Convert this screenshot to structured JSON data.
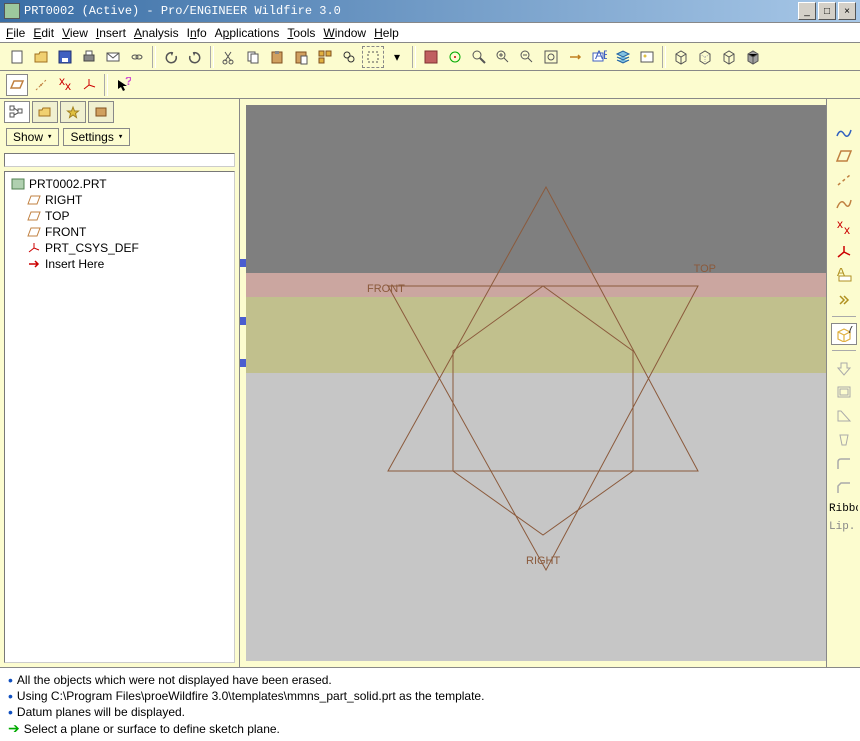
{
  "window": {
    "title": "PRT0002 (Active) - Pro/ENGINEER Wildfire 3.0"
  },
  "menu": {
    "file": "File",
    "edit": "Edit",
    "view": "View",
    "insert": "Insert",
    "analysis": "Analysis",
    "info": "Info",
    "applications": "Applications",
    "tools": "Tools",
    "window": "Window",
    "help": "Help"
  },
  "sidebar": {
    "show": "Show",
    "settings": "Settings",
    "root": "PRT0002.PRT",
    "items": [
      {
        "label": "RIGHT"
      },
      {
        "label": "TOP"
      },
      {
        "label": "FRONT"
      },
      {
        "label": "PRT_CSYS_DEF"
      },
      {
        "label": "Insert Here"
      }
    ]
  },
  "canvas": {
    "labels": {
      "top": "TOP",
      "front": "FRONT",
      "right": "RIGHT"
    }
  },
  "right_panel": {
    "ribbon": "Ribbon...",
    "lip": "Lip..."
  },
  "status": {
    "line1": "All the objects which were not displayed have been erased.",
    "line2": "Using C:\\Program Files\\proeWildfire 3.0\\templates\\mmns_part_solid.prt as the template.",
    "line3": "Datum planes will be displayed.",
    "line4": "Select a plane or surface to define sketch plane."
  }
}
